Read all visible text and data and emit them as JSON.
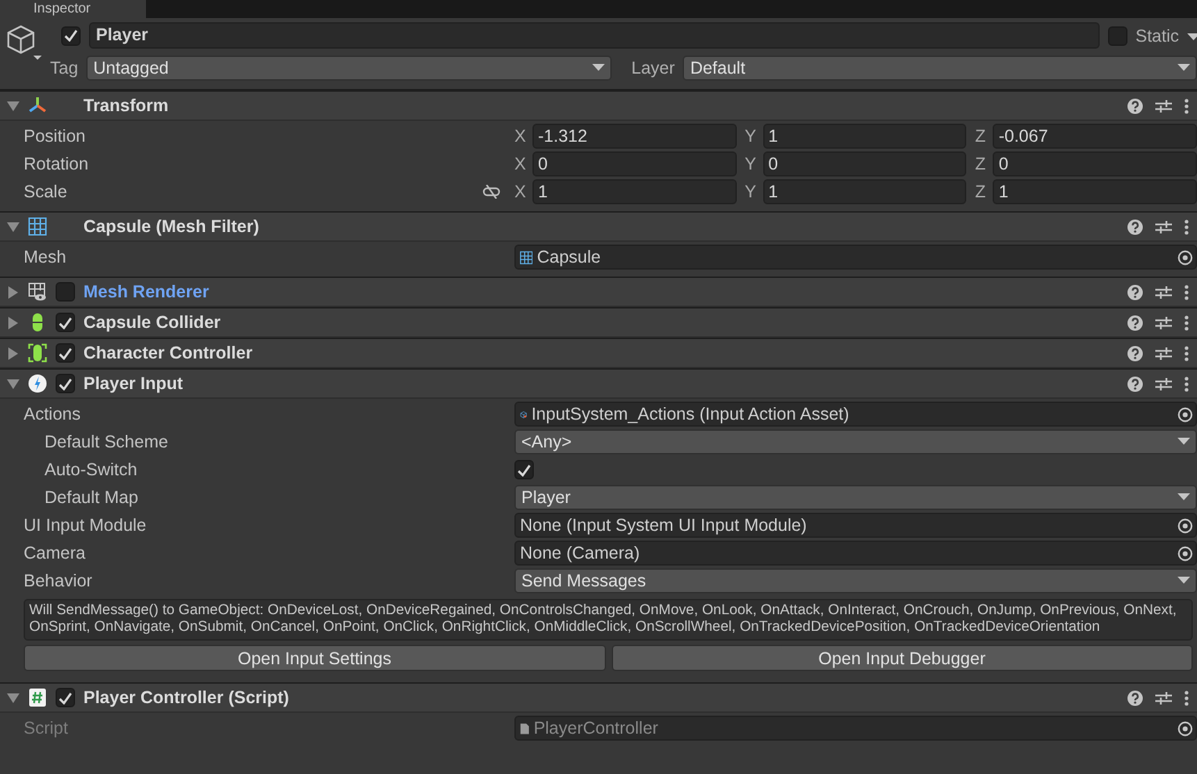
{
  "tab": {
    "label": "Inspector"
  },
  "game_object": {
    "active": true,
    "name": "Player",
    "static": false,
    "static_label": "Static",
    "tag_label": "Tag",
    "tag": "Untagged",
    "layer_label": "Layer",
    "layer": "Default"
  },
  "components": [
    {
      "kind": "transform",
      "title": "Transform",
      "expanded": true,
      "overridden": false,
      "vectors": [
        {
          "label": "Position",
          "linked": false,
          "values": [
            {
              "axis": "X",
              "value": "-1.312"
            },
            {
              "axis": "Y",
              "value": "1"
            },
            {
              "axis": "Z",
              "value": "-0.067"
            }
          ]
        },
        {
          "label": "Rotation",
          "linked": false,
          "values": [
            {
              "axis": "X",
              "value": "0"
            },
            {
              "axis": "Y",
              "value": "0"
            },
            {
              "axis": "Z",
              "value": "0"
            }
          ]
        },
        {
          "label": "Scale",
          "linked": true,
          "values": [
            {
              "axis": "X",
              "value": "1"
            },
            {
              "axis": "Y",
              "value": "1"
            },
            {
              "axis": "Z",
              "value": "1"
            }
          ]
        }
      ]
    },
    {
      "kind": "mesh_filter",
      "title": "Capsule (Mesh Filter)",
      "expanded": true,
      "overridden": false,
      "fields": [
        {
          "kind": "object",
          "label": "Mesh",
          "value": "Capsule",
          "disabled": false
        }
      ]
    },
    {
      "kind": "mesh_renderer",
      "title": "Mesh Renderer",
      "expanded": false,
      "overridden": true,
      "enabled": false
    },
    {
      "kind": "collider",
      "title": "Capsule Collider",
      "expanded": false,
      "overridden": false,
      "enabled": true
    },
    {
      "kind": "character_controller",
      "title": "Character Controller",
      "expanded": false,
      "overridden": false,
      "enabled": true
    },
    {
      "kind": "player_input",
      "title": "Player Input",
      "expanded": true,
      "overridden": false,
      "enabled": true,
      "fields": [
        {
          "kind": "object",
          "label": "Actions",
          "value": "InputSystem_Actions (Input Action Asset)",
          "disabled": false,
          "children": [
            {
              "kind": "dropdown",
              "label": "Default Scheme",
              "value": "<Any>",
              "disabled": false
            },
            {
              "kind": "checkbox",
              "label": "Auto-Switch",
              "checked": true,
              "disabled": false
            },
            {
              "kind": "dropdown",
              "label": "Default Map",
              "value": "Player",
              "disabled": false
            }
          ]
        },
        {
          "kind": "object",
          "label": "UI Input Module",
          "value": "None (Input System UI Input Module)",
          "disabled": false
        },
        {
          "kind": "object",
          "label": "Camera",
          "value": "None (Camera)",
          "disabled": false
        },
        {
          "kind": "dropdown",
          "label": "Behavior",
          "value": "Send Messages",
          "disabled": false
        },
        {
          "kind": "help",
          "text": "Will SendMessage() to GameObject: OnDeviceLost, OnDeviceRegained, OnControlsChanged, OnMove, OnLook, OnAttack, OnInteract, OnCrouch, OnJump, OnPrevious, OnNext, OnSprint, OnNavigate, OnSubmit, OnCancel, OnPoint, OnClick, OnRightClick, OnMiddleClick, OnScrollWheel, OnTrackedDevicePosition, OnTrackedDeviceOrientation",
          "disabled": false
        },
        {
          "kind": "buttons",
          "buttons": [
            "Open Input Settings",
            "Open Input Debugger"
          ],
          "disabled": false
        }
      ]
    },
    {
      "kind": "script",
      "title": "Player Controller (Script)",
      "expanded": true,
      "overridden": false,
      "enabled": true,
      "fields": [
        {
          "kind": "object",
          "label": "Script",
          "value": "PlayerController",
          "disabled": true
        }
      ]
    }
  ]
}
